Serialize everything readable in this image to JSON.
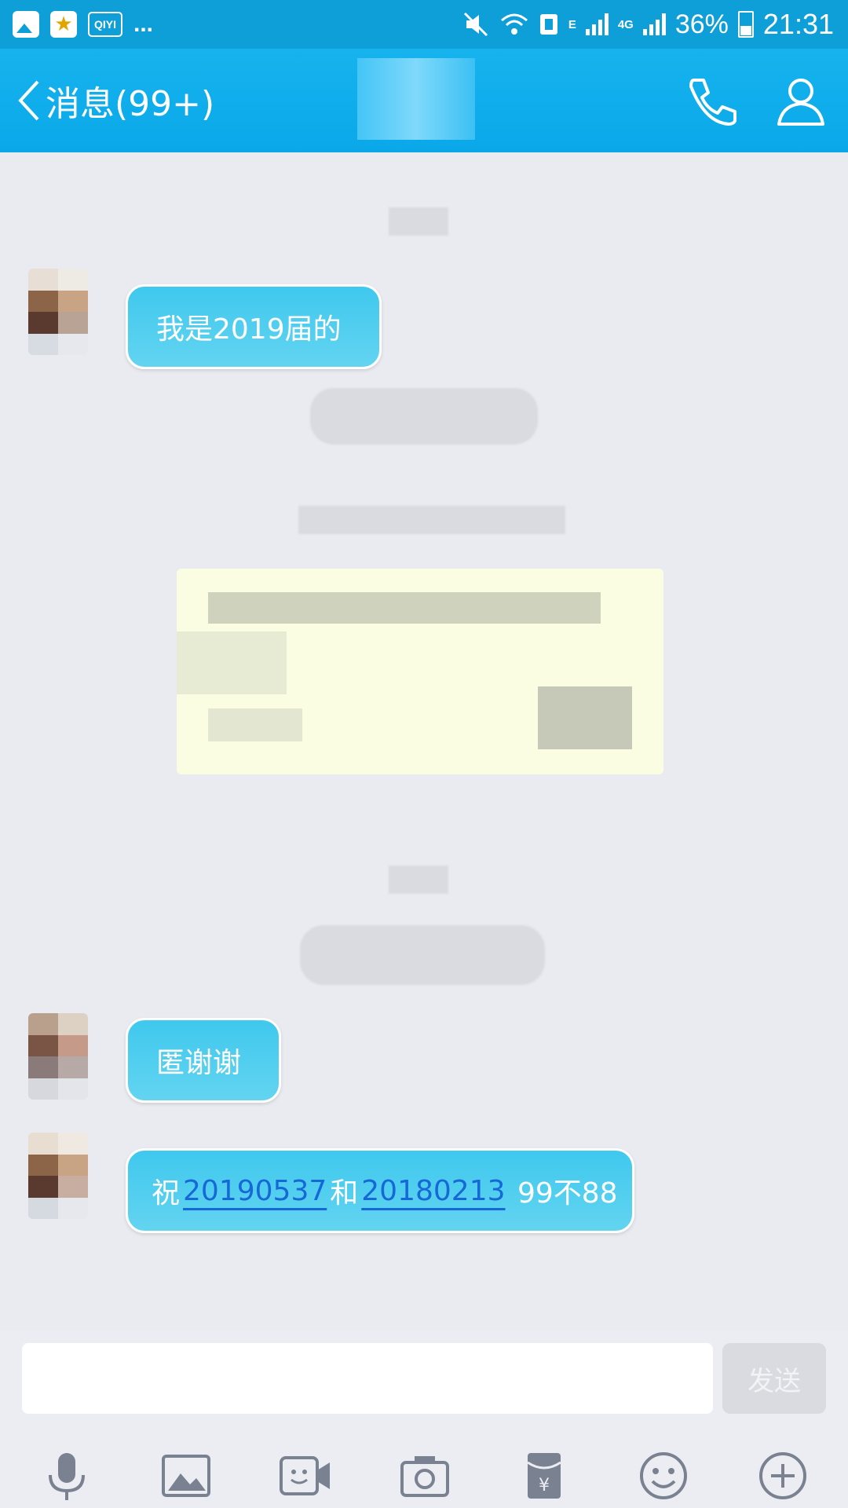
{
  "status_bar": {
    "qiyi_label": "QIYI",
    "overflow": "...",
    "network_e": "E",
    "network_4g": "4G",
    "battery": "36%",
    "time": "21:31"
  },
  "header": {
    "back_label": "消息(99+)"
  },
  "messages": [
    {
      "text": "我是2019届的"
    },
    {
      "text": "匿谢谢"
    },
    {
      "prefix": "祝",
      "link1": "20190537",
      "middle": "和",
      "link2": "20180213",
      "suffix": " 99不88"
    }
  ],
  "input": {
    "placeholder": "",
    "send_label": "发送"
  },
  "toolbar": [
    "mic-icon",
    "image-icon",
    "video-chat-icon",
    "camera-icon",
    "red-packet-icon",
    "emoji-icon",
    "plus-icon"
  ],
  "colors": {
    "header": "#0aa8e9",
    "bubble": "#3fc8ee",
    "link": "#1668d6",
    "background": "#e9ebf0"
  }
}
